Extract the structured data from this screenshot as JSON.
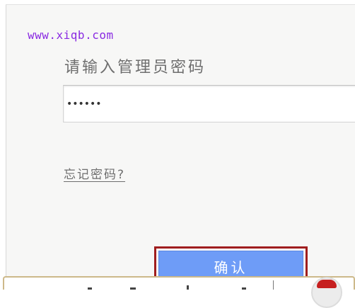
{
  "watermark": {
    "text": "www.xiqb.com",
    "color": "#8a2be2"
  },
  "login": {
    "prompt": "请输入管理员密码",
    "password_value": "••••••",
    "forgot_link": "忘记密码?"
  },
  "confirm": {
    "label": "确认",
    "button_color": "#6e9cf7",
    "highlight_color": "#a01e1e"
  },
  "icons": {
    "avatar": "user-avatar-icon"
  }
}
